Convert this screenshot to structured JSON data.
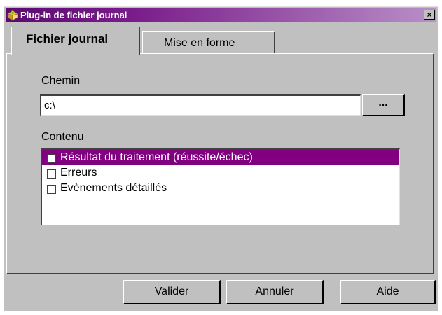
{
  "window": {
    "title": "Plug-in de fichier journal",
    "close_label": "×"
  },
  "tabs": [
    {
      "label": "Fichier journal",
      "active": true
    },
    {
      "label": "Mise en forme",
      "active": false
    }
  ],
  "path": {
    "label": "Chemin",
    "value": "c:\\",
    "browse_label": "..."
  },
  "content": {
    "label": "Contenu",
    "items": [
      {
        "label": "Résultat du traitement (réussite/échec)",
        "checked": false,
        "selected": true
      },
      {
        "label": "Erreurs",
        "checked": false,
        "selected": false
      },
      {
        "label": "Evènements détaillés",
        "checked": false,
        "selected": false
      }
    ]
  },
  "buttons": {
    "ok": "Valider",
    "cancel": "Annuler",
    "help": "Aide"
  },
  "colors": {
    "selection": "#800080",
    "titlebar_start": "#5c0a72",
    "titlebar_end": "#b98fc8",
    "face": "#c0c0c0"
  }
}
